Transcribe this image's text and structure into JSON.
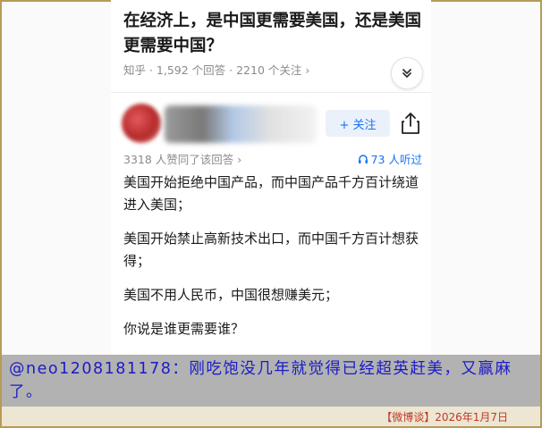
{
  "question": {
    "title": "在经济上，是中国更需要美国，还是美国更需要中国？",
    "meta": "知乎 · 1,592 个回答 · 2210 个关注 ›"
  },
  "answer": {
    "follow_label": "+ 关注",
    "agree_text": "3318 人赞同了该回答 ›",
    "listen_text": "73 人听过",
    "paragraphs": [
      "美国开始拒绝中国产品，而中国产品千方百计绕道进入美国；",
      "美国开始禁止高新技术出口，而中国千方百计想获得；",
      "美国不用人民币，中国很想赚美元；",
      "你说是谁更需要谁？"
    ]
  },
  "caption": {
    "text": "@neo1208181178：刚吃饱没几年就觉得已经超英赶美，又赢麻了。"
  },
  "footer": {
    "text": "【微博谈】2026年1月7日"
  },
  "colors": {
    "accent": "#1772f6",
    "caption_text": "#1b1bc8",
    "caption_bg": "#b2b2b2",
    "footer_text": "#c0392b",
    "border": "#b79a5a"
  }
}
